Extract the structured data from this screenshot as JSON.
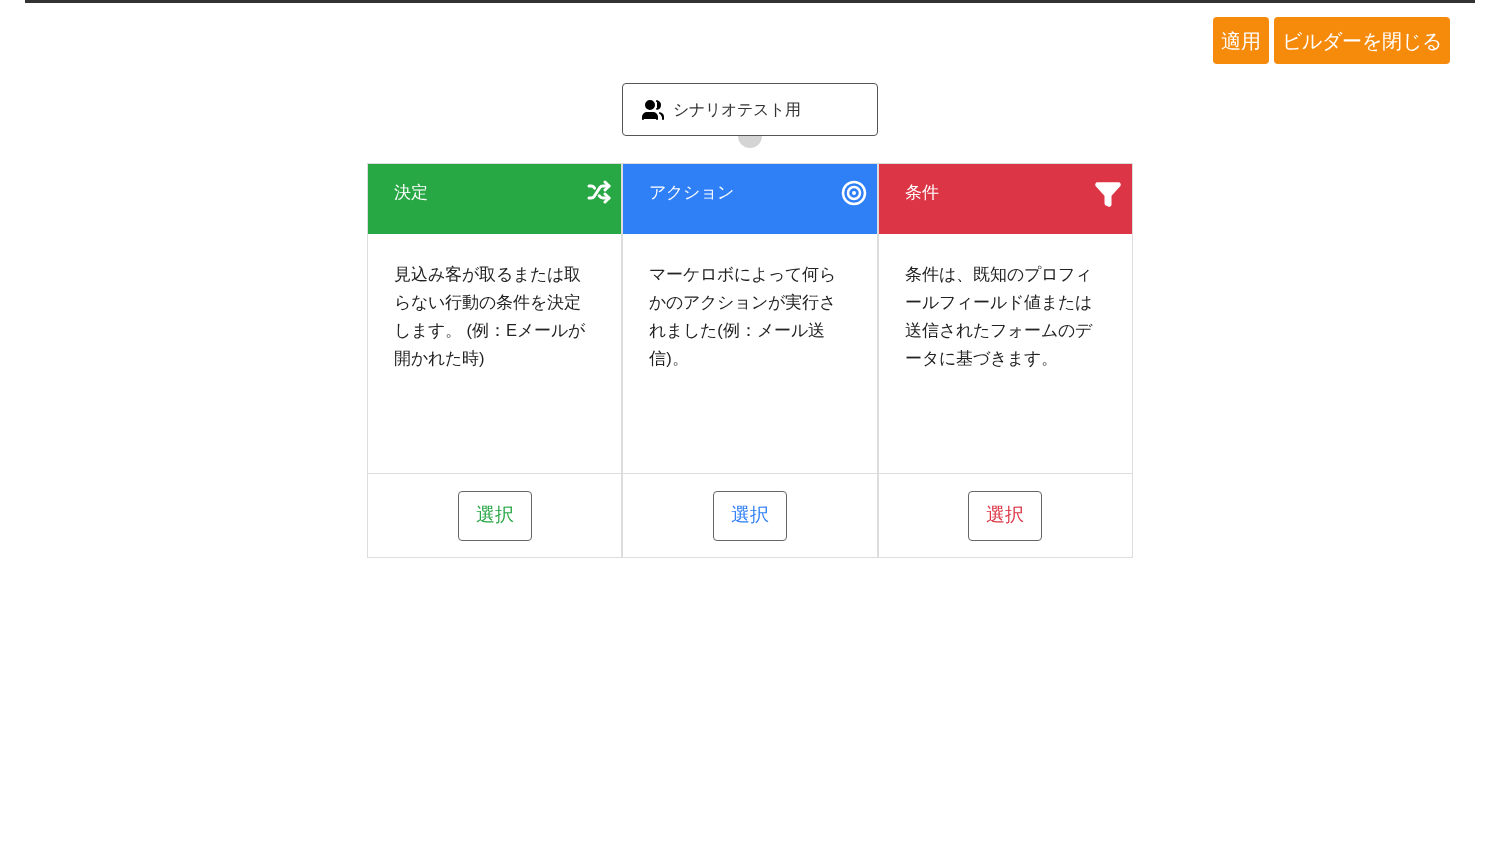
{
  "toolbar": {
    "buttons": [
      "適用",
      "ビルダーを閉じる"
    ]
  },
  "start_node": {
    "label": "シナリオテスト用"
  },
  "cards": [
    {
      "kind": "decision",
      "title": "決定",
      "color": "#28a745",
      "description": "見込み客が取るまたは取らない行動の条件を決定します。 (例：Eメールが開かれた時)",
      "button": "選択"
    },
    {
      "kind": "action",
      "title": "アクション",
      "color": "#2f7ff7",
      "description": "マーケロボによって何らかのアクションが実行されました(例：メール送信)。",
      "button": "選択"
    },
    {
      "kind": "condition",
      "title": "条件",
      "color": "#dc3545",
      "description": "条件は、既知のプロフィールフィールド値または送信されたフォームのデータに基づきます。",
      "button": "選択"
    }
  ]
}
